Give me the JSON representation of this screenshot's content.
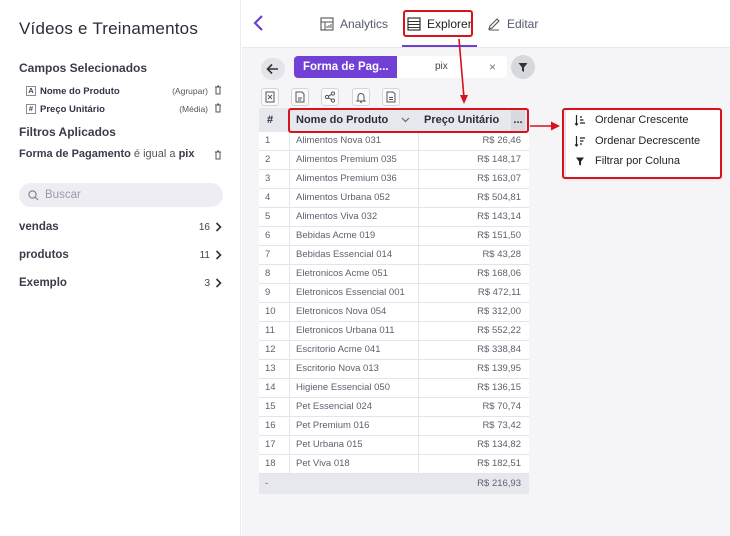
{
  "sidebar": {
    "title": "Vídeos e Treinamentos",
    "selected_fields_heading": "Campos Selecionados",
    "fields": [
      {
        "type": "A",
        "name": "Nome do Produto",
        "aggregation": "(Agrupar)"
      },
      {
        "type": "#",
        "name": "Preço Unitário",
        "aggregation": "(Média)"
      }
    ],
    "filters_heading": "Filtros Aplicados",
    "filter": {
      "field": "Forma de Pagamento",
      "operator": " é igual a ",
      "value": "pix"
    },
    "search_placeholder": "Buscar",
    "folders": [
      {
        "name": "vendas",
        "count": "16"
      },
      {
        "name": "produtos",
        "count": "11"
      },
      {
        "name": "Exemplo",
        "count": "3"
      }
    ]
  },
  "tabs": [
    {
      "label": "Analytics",
      "icon": "analytics-icon"
    },
    {
      "label": "Explorer",
      "icon": "table-icon"
    },
    {
      "label": "Editar",
      "icon": "pencil-icon"
    }
  ],
  "filter_bar": {
    "field": "Forma de Pag...",
    "value": "pix",
    "clear": "×"
  },
  "table": {
    "columns": [
      "#",
      "Nome do Produto",
      "Preço Unitário",
      "..."
    ],
    "rows": [
      {
        "n": "1",
        "name": "Alimentos Nova 031",
        "price": "R$ 26,46"
      },
      {
        "n": "2",
        "name": "Alimentos Premium 035",
        "price": "R$ 148,17"
      },
      {
        "n": "3",
        "name": "Alimentos Premium 036",
        "price": "R$ 163,07"
      },
      {
        "n": "4",
        "name": "Alimentos Urbana 052",
        "price": "R$ 504,81"
      },
      {
        "n": "5",
        "name": "Alimentos Viva 032",
        "price": "R$ 143,14"
      },
      {
        "n": "6",
        "name": "Bebidas Acme 019",
        "price": "R$ 151,50"
      },
      {
        "n": "7",
        "name": "Bebidas Essencial 014",
        "price": "R$ 43,28"
      },
      {
        "n": "8",
        "name": "Eletronicos Acme 051",
        "price": "R$ 168,06"
      },
      {
        "n": "9",
        "name": "Eletronicos Essencial 001",
        "price": "R$ 472,11"
      },
      {
        "n": "10",
        "name": "Eletronicos Nova 054",
        "price": "R$ 312,00"
      },
      {
        "n": "11",
        "name": "Eletronicos Urbana 011",
        "price": "R$ 552,22"
      },
      {
        "n": "12",
        "name": "Escritorio Acme 041",
        "price": "R$ 338,84"
      },
      {
        "n": "13",
        "name": "Escritorio Nova 013",
        "price": "R$ 139,95"
      },
      {
        "n": "14",
        "name": "Higiene Essencial 050",
        "price": "R$ 136,15"
      },
      {
        "n": "15",
        "name": "Pet Essencial 024",
        "price": "R$ 70,74"
      },
      {
        "n": "16",
        "name": "Pet Premium 016",
        "price": "R$ 73,42"
      },
      {
        "n": "17",
        "name": "Pet Urbana 015",
        "price": "R$ 134,82"
      },
      {
        "n": "18",
        "name": "Pet Viva 018",
        "price": "R$ 182,51"
      }
    ],
    "footer": {
      "n": "-",
      "price": "R$ 216,93"
    }
  },
  "column_menu": [
    {
      "label": "Ordenar Crescente",
      "icon": "sort-ascending-icon"
    },
    {
      "label": "Ordenar Decrescente",
      "icon": "sort-descending-icon"
    },
    {
      "label": "Filtrar por Coluna",
      "icon": "filter-icon"
    }
  ],
  "colors": {
    "accent": "#7140d4",
    "highlight": "#d8121b"
  }
}
